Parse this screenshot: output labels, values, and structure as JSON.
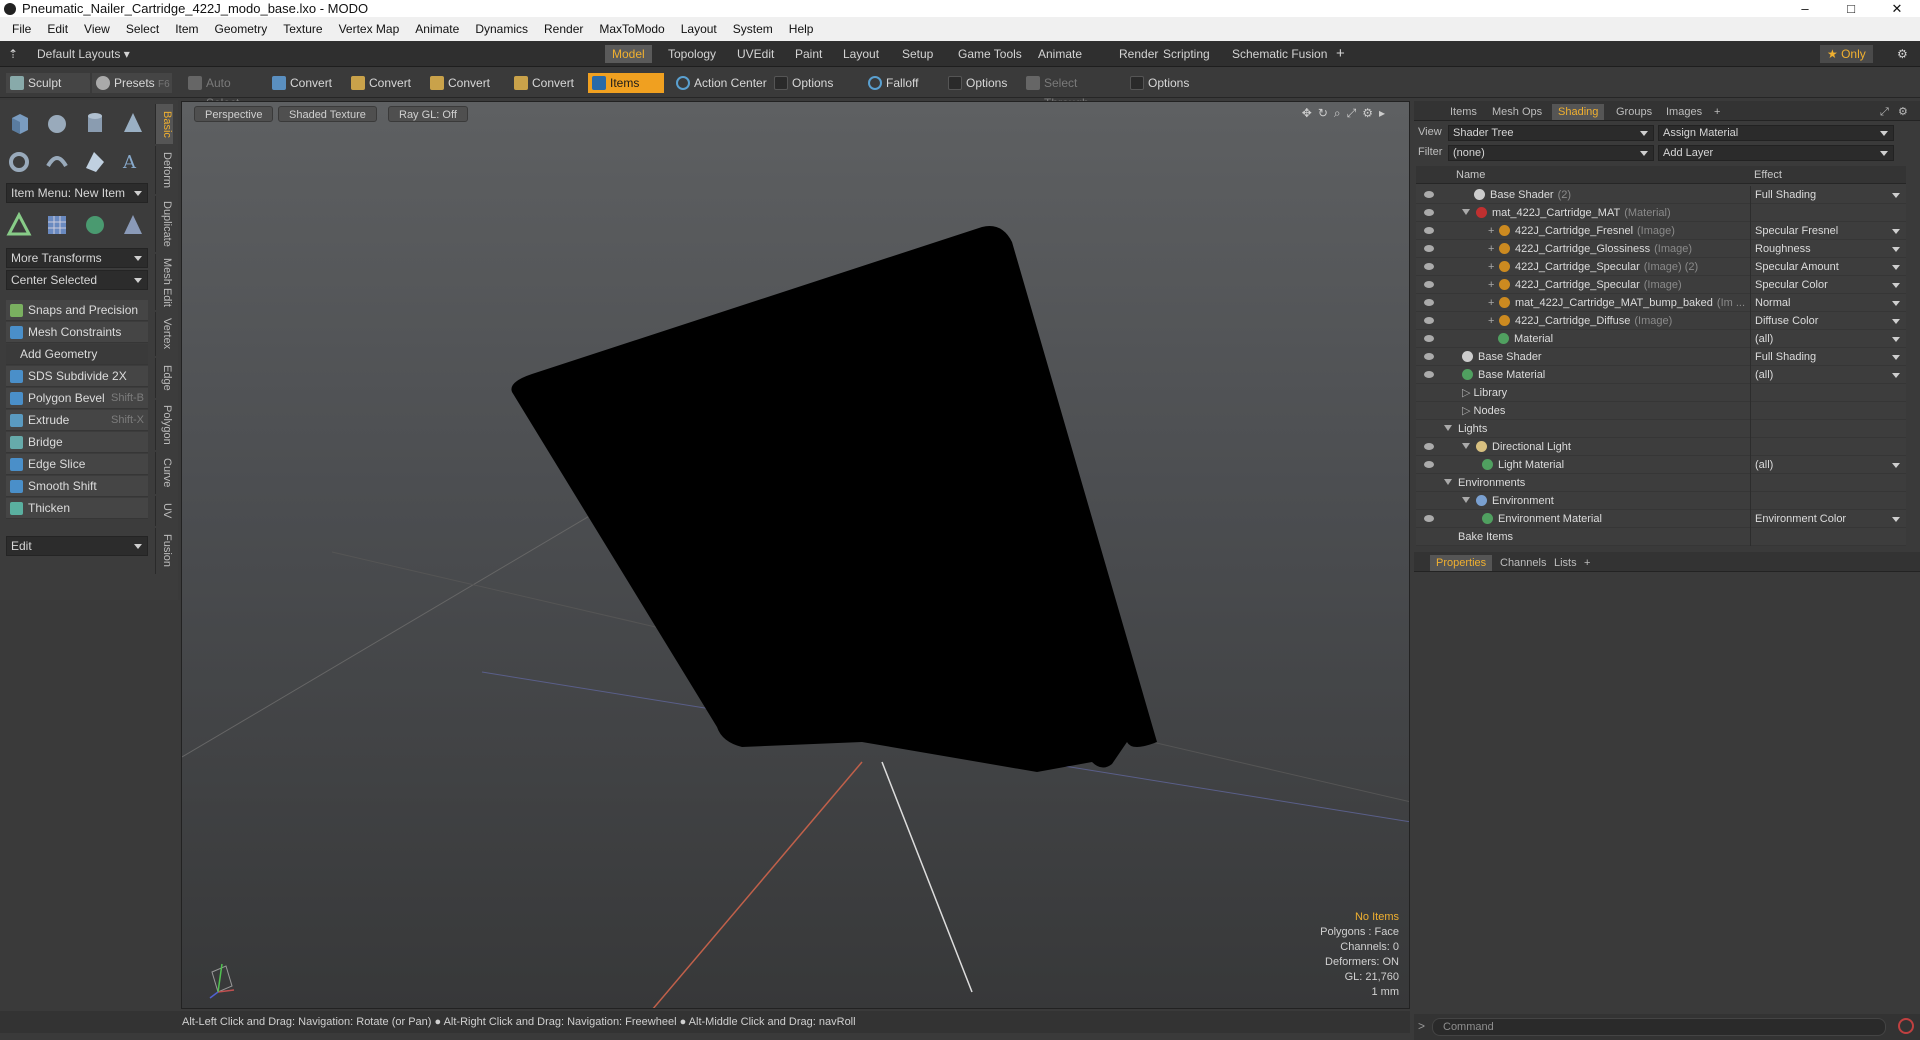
{
  "window": {
    "title": "Pneumatic_Nailer_Cartridge_422J_modo_base.lxo - MODO",
    "minimize": "–",
    "maximize": "□",
    "close": "✕"
  },
  "menu": [
    "File",
    "Edit",
    "View",
    "Select",
    "Item",
    "Geometry",
    "Texture",
    "Vertex Map",
    "Animate",
    "Dynamics",
    "Render",
    "MaxToModo",
    "Layout",
    "System",
    "Help"
  ],
  "layout_bar": {
    "layout_select": "Default Layouts ▾",
    "tabs": [
      "Model",
      "Topology",
      "UVEdit",
      "Paint",
      "Layout",
      "Setup",
      "Game Tools",
      "Animate",
      "Render",
      "Scripting",
      "Schematic Fusion",
      "+"
    ],
    "active_tab": "Model",
    "only_label": "★ Only"
  },
  "toolbar": {
    "sculpt": "Sculpt",
    "presets": "Presets",
    "presets_key": "F6",
    "auto_select": "Auto Select",
    "convert1": "Convert",
    "convert2": "Convert",
    "convert3": "Convert",
    "convert4": "Convert",
    "items": "Items",
    "action_center": "Action Center",
    "options1": "Options",
    "falloff": "Falloff",
    "options2": "Options",
    "select_through": "Select Through",
    "options3": "Options"
  },
  "left_panel": {
    "item_menu": "Item Menu: New Item",
    "more_transforms": "More Transforms",
    "center_selected": "Center Selected",
    "snaps": "Snaps and Precision",
    "mesh_constraints": "Mesh Constraints",
    "add_geometry": "Add Geometry",
    "tools": [
      {
        "label": "SDS Subdivide 2X",
        "shortcut": ""
      },
      {
        "label": "Polygon Bevel",
        "shortcut": "Shift-B"
      },
      {
        "label": "Extrude",
        "shortcut": "Shift-X"
      },
      {
        "label": "Bridge",
        "shortcut": ""
      },
      {
        "label": "Edge Slice",
        "shortcut": ""
      },
      {
        "label": "Smooth Shift",
        "shortcut": ""
      },
      {
        "label": "Thicken",
        "shortcut": ""
      }
    ],
    "edit": "Edit",
    "vtabs": [
      "Basic",
      "Deform",
      "Duplicate",
      "Mesh Edit",
      "Vertex",
      "Edge",
      "Polygon",
      "Curve",
      "UV",
      "Fusion"
    ]
  },
  "viewport": {
    "perspective": "Perspective",
    "shaded": "Shaded Texture",
    "raygl": "Ray GL: Off",
    "info": {
      "items": "No Items",
      "polygons": "Polygons : Face",
      "channels": "Channels: 0",
      "deformers": "Deformers: ON",
      "gl": "GL: 21,760",
      "scale": "1 mm"
    }
  },
  "status": "Alt-Left Click and Drag: Navigation: Rotate (or Pan) ● Alt-Right Click and Drag: Navigation: Freewheel ● Alt-Middle Click and Drag: navRoll",
  "right_panel": {
    "tabs": [
      "Items",
      "Mesh Ops",
      "Shading",
      "Groups",
      "Images",
      "+"
    ],
    "active_tab": "Shading",
    "view_label": "View",
    "view_value": "Shader Tree",
    "assign_material": "Assign Material",
    "filter_label": "Filter",
    "filter_value": "(none)",
    "add_layer": "Add Layer",
    "col_name": "Name",
    "col_effect": "Effect",
    "rows": [
      {
        "name": "Base Shader",
        "sub": "(2)",
        "effect": "Full Shading"
      },
      {
        "name": "mat_422J_Cartridge_MAT",
        "sub": "(Material)",
        "effect": ""
      },
      {
        "name": "422J_Cartridge_Fresnel",
        "sub": "(Image)",
        "effect": "Specular Fresnel"
      },
      {
        "name": "422J_Cartridge_Glossiness",
        "sub": "(Image)",
        "effect": "Roughness"
      },
      {
        "name": "422J_Cartridge_Specular",
        "sub": "(Image) (2)",
        "effect": "Specular Amount"
      },
      {
        "name": "422J_Cartridge_Specular",
        "sub": "(Image)",
        "effect": "Specular Color"
      },
      {
        "name": "mat_422J_Cartridge_MAT_bump_baked",
        "sub": "(Im ...",
        "effect": "Normal"
      },
      {
        "name": "422J_Cartridge_Diffuse",
        "sub": "(Image)",
        "effect": "Diffuse Color"
      },
      {
        "name": "Material",
        "sub": "",
        "effect": "(all)"
      },
      {
        "name": "Base Shader",
        "sub": "",
        "effect": "Full Shading"
      },
      {
        "name": "Base Material",
        "sub": "",
        "effect": "(all)"
      },
      {
        "name": "Library",
        "sub": "",
        "effect": ""
      },
      {
        "name": "Nodes",
        "sub": "",
        "effect": ""
      },
      {
        "name": "Lights",
        "sub": "",
        "effect": ""
      },
      {
        "name": "Directional Light",
        "sub": "",
        "effect": ""
      },
      {
        "name": "Light Material",
        "sub": "",
        "effect": "(all)"
      },
      {
        "name": "Environments",
        "sub": "",
        "effect": ""
      },
      {
        "name": "Environment",
        "sub": "",
        "effect": ""
      },
      {
        "name": "Environment Material",
        "sub": "",
        "effect": "Environment Color"
      },
      {
        "name": "Bake Items",
        "sub": "",
        "effect": ""
      }
    ],
    "props_tabs": [
      "Properties",
      "Channels",
      "Lists",
      "+"
    ],
    "command_placeholder": "Command"
  }
}
